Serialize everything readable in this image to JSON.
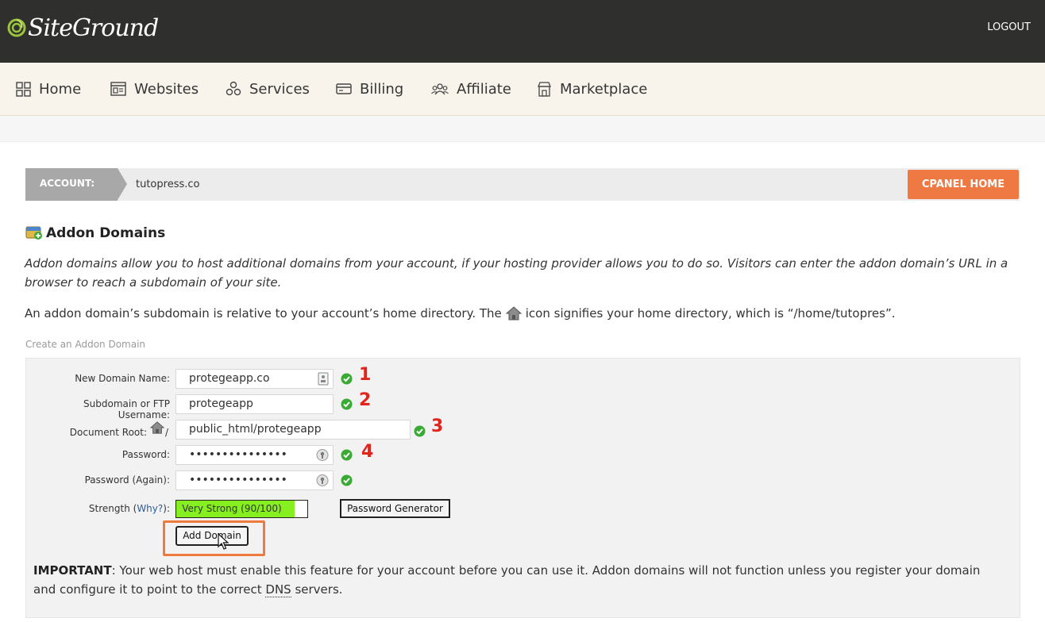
{
  "header": {
    "brand": "SiteGround",
    "logout_label": "LOGOUT"
  },
  "nav": {
    "items": [
      {
        "label": "Home",
        "icon": "grid-icon"
      },
      {
        "label": "Websites",
        "icon": "websites-icon"
      },
      {
        "label": "Services",
        "icon": "services-icon"
      },
      {
        "label": "Billing",
        "icon": "card-icon"
      },
      {
        "label": "Affiliate",
        "icon": "people-icon"
      },
      {
        "label": "Marketplace",
        "icon": "store-icon"
      }
    ]
  },
  "account": {
    "label": "ACCOUNT:",
    "domain": "tutopress.co",
    "cpanel_button": "CPANEL HOME"
  },
  "page": {
    "title": "Addon Domains",
    "description": "Addon domains allow you to host additional domains from your account, if your hosting provider allows you to do so. Visitors can enter the addon domain’s URL in a browser to reach a subdomain of your site.",
    "note_before_icon": "An addon domain’s subdomain is relative to your account’s home directory. The",
    "note_after_icon": "icon signifies your home directory, which is “/home/tutopres”.",
    "section_label": "Create an Addon Domain"
  },
  "form": {
    "new_domain_label": "New Domain Name:",
    "new_domain_value": "protegeapp.co",
    "subdomain_label": "Subdomain or FTP Username:",
    "subdomain_value": "protegeapp",
    "docroot_label": "Document Root:",
    "docroot_prefix": "/",
    "docroot_value": "public_html/protegeapp",
    "password_label": "Password:",
    "password_value": "•••••••••••••••",
    "password_again_label": "Password (Again):",
    "password_again_value": "•••••••••••••••",
    "strength_label": "Strength (",
    "strength_why": "Why?",
    "strength_label_end": "):",
    "strength_text": "Very Strong (90/100)",
    "strength_percent": 90,
    "password_generator_label": "Password Generator",
    "add_domain_label": "Add Domain"
  },
  "annotations": [
    "1",
    "2",
    "3",
    "4"
  ],
  "important": {
    "prefix": "IMPORTANT",
    "text_before_dns": ": Your web host must enable this feature for your account before you can use it. Addon domains will not function unless you register your domain and configure it to point to the correct ",
    "dns": "DNS",
    "text_after_dns": " servers."
  },
  "colors": {
    "header_bg": "#2f2f2d",
    "nav_bg": "#f8f4ec",
    "accent_orange": "#ef7943",
    "check_green": "#3aa935",
    "strength_green": "#86ef1f",
    "annotation_red": "#e3241b"
  }
}
